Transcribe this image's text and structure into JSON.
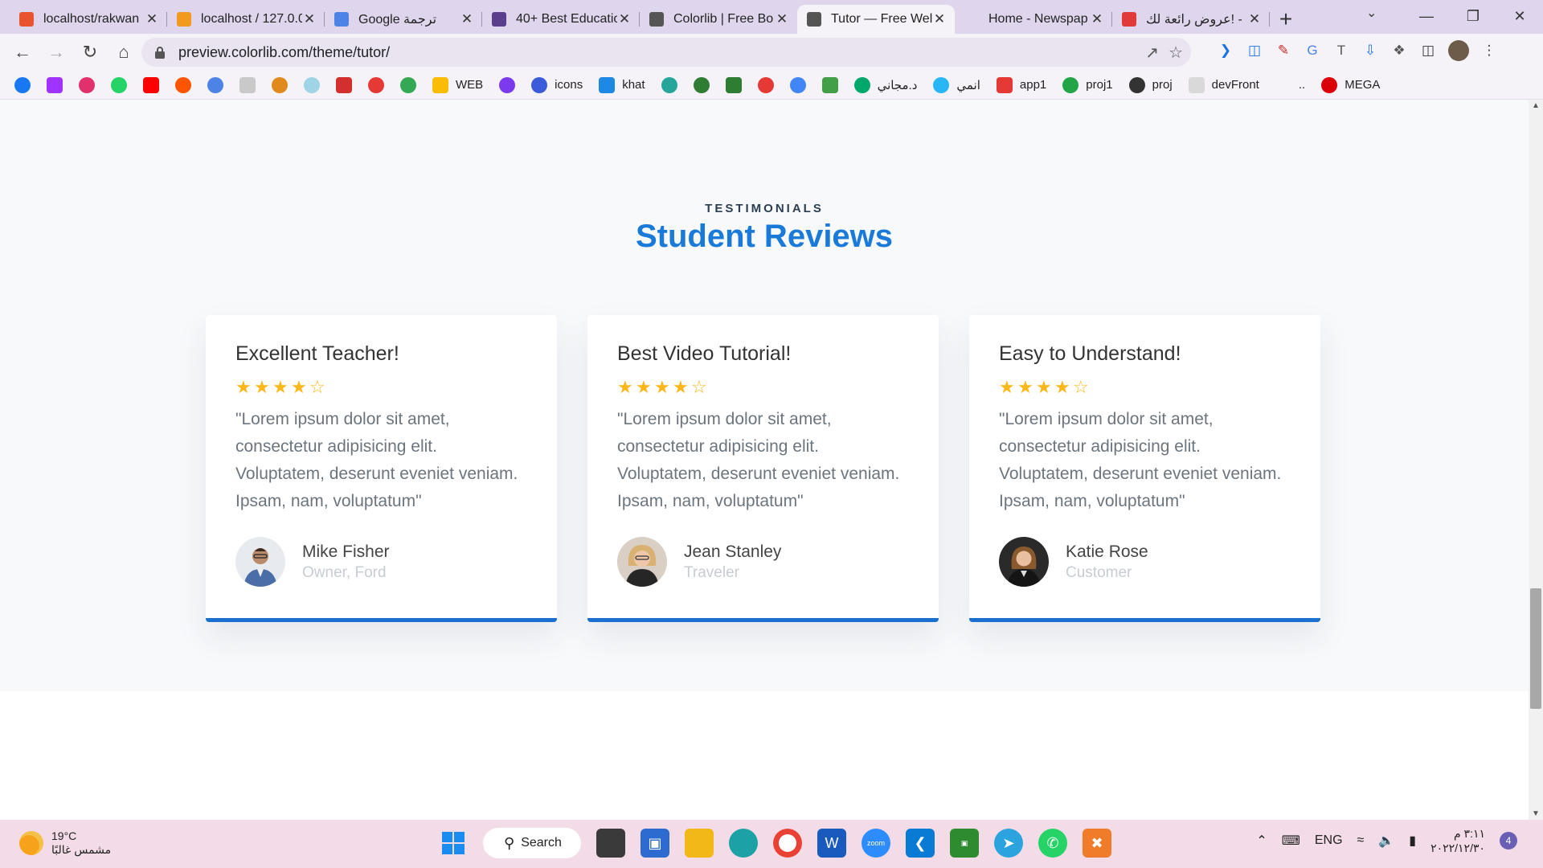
{
  "browser": {
    "tabs": [
      {
        "title": "localhost/rakwan",
        "color": "#e8542f",
        "active": false
      },
      {
        "title": "localhost / 127.0.0",
        "color": "#f29a1e",
        "active": false
      },
      {
        "title": "Google ترجمة",
        "color": "#4d82e6",
        "active": false
      },
      {
        "title": "40+ Best Educatio",
        "color": "#5b3f8c",
        "active": false
      },
      {
        "title": "Colorlib | Free Bo",
        "color": "#555555",
        "active": false
      },
      {
        "title": "Tutor — Free Wel",
        "color": "#555555",
        "active": true
      },
      {
        "title": "Home - Newspap",
        "color": "#dfd6ee",
        "active": false
      },
      {
        "title": "عروض رائعة لك! -",
        "color": "#e03a3a",
        "active": false
      }
    ],
    "url": "preview.colorlib.com/theme/tutor/",
    "bookmarks": [
      {
        "label": "",
        "color": "#1877f2"
      },
      {
        "label": "",
        "color": "#a033ff"
      },
      {
        "label": "",
        "color": "#e1306c"
      },
      {
        "label": "",
        "color": "#25d366"
      },
      {
        "label": "",
        "color": "#ff0000"
      },
      {
        "label": "",
        "color": "#ff5500"
      },
      {
        "label": "",
        "color": "#4d82e6"
      },
      {
        "label": "",
        "color": "#c9c9c9"
      },
      {
        "label": "",
        "color": "#e08a1e"
      },
      {
        "label": "",
        "color": "#9fd4e6"
      },
      {
        "label": "",
        "color": "#d32f2f"
      },
      {
        "label": "",
        "color": "#e53935"
      },
      {
        "label": "",
        "color": "#34a853"
      },
      {
        "label": "WEB",
        "color": "#fbbc04"
      },
      {
        "label": "",
        "color": "#7c3aed"
      },
      {
        "label": "icons",
        "color": "#3b5bdb"
      },
      {
        "label": "khat",
        "color": "#1e88e5"
      },
      {
        "label": "",
        "color": "#26a69a"
      },
      {
        "label": "",
        "color": "#2e7d32"
      },
      {
        "label": "",
        "color": "#2e7d32"
      },
      {
        "label": "",
        "color": "#e53935"
      },
      {
        "label": "",
        "color": "#4285f4"
      },
      {
        "label": "",
        "color": "#43a047"
      },
      {
        "label": "د.مجاني",
        "color": "#00a86b"
      },
      {
        "label": "انمي",
        "color": "#29b6f6"
      },
      {
        "label": "app1",
        "color": "#e53935"
      },
      {
        "label": "proj1",
        "color": "#22a447"
      },
      {
        "label": "proj",
        "color": "#333333"
      },
      {
        "label": "devFront",
        "color": "#d9d9d9"
      },
      {
        "label": "..",
        "color": "#f5f2f8"
      },
      {
        "label": "MEGA",
        "color": "#d90007"
      }
    ]
  },
  "page": {
    "eyebrow": "TESTIMONIALS",
    "heading": "Student Reviews",
    "reviews": [
      {
        "title": "Excellent Teacher!",
        "rating": 4,
        "max_rating": 5,
        "quote": "\"Lorem ipsum dolor sit amet, consectetur adipisicing elit. Voluptatem, deserunt eveniet veniam. Ipsam, nam, voluptatum\"",
        "author": "Mike Fisher",
        "role": "Owner, Ford"
      },
      {
        "title": "Best Video Tutorial!",
        "rating": 4,
        "max_rating": 5,
        "quote": "\"Lorem ipsum dolor sit amet, consectetur adipisicing elit. Voluptatem, deserunt eveniet veniam. Ipsam, nam, voluptatum\"",
        "author": "Jean Stanley",
        "role": "Traveler"
      },
      {
        "title": "Easy to Understand!",
        "rating": 4,
        "max_rating": 5,
        "quote": "\"Lorem ipsum dolor sit amet, consectetur adipisicing elit. Voluptatem, deserunt eveniet veniam. Ipsam, nam, voluptatum\"",
        "author": "Katie Rose",
        "role": "Customer"
      }
    ],
    "colors": {
      "accent": "#1a7ad9",
      "card_border": "#1a6fd1",
      "stars": "#fbb61a"
    }
  },
  "taskbar": {
    "weather_temp": "19°C",
    "weather_desc": "مشمس غالبًا",
    "search_label": "Search",
    "language": "ENG",
    "time": "٣:١١ م",
    "date": "٢٠٢٢/١٢/٣٠",
    "notifications": "4"
  }
}
